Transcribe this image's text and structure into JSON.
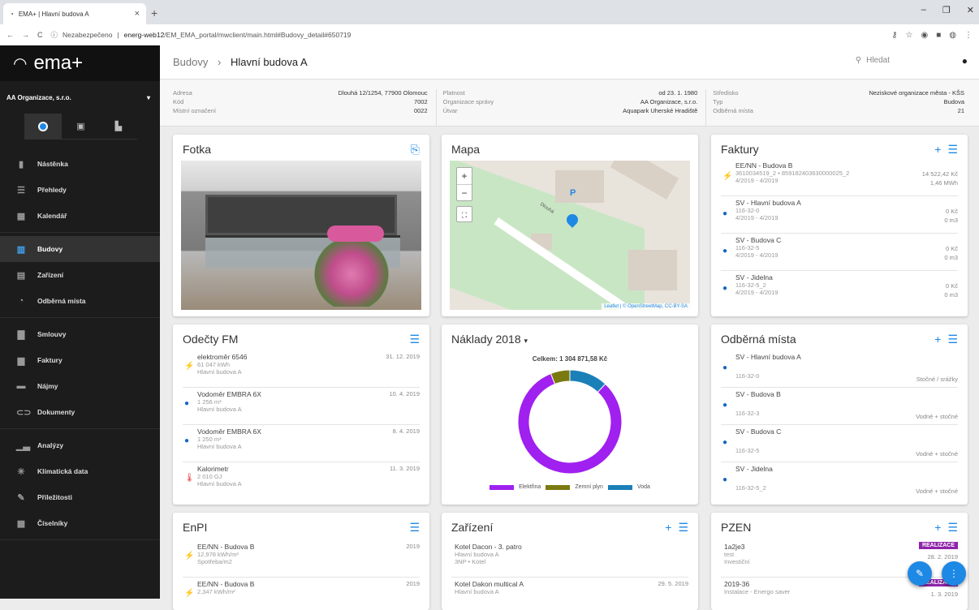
{
  "browser": {
    "tab_title": "EMA+ | Hlavní budova A",
    "security": "Nezabezpečeno",
    "host": "energ-web12",
    "path": "/EM_EMA_portal/mwclient/main.html#Budovy_detail#650719"
  },
  "app": {
    "logo": "ema+",
    "organization": "AA Organizace, s.r.o."
  },
  "nav": [
    {
      "label": "Nástěnka",
      "icon": "dashboard-icon",
      "glyph": "▮"
    },
    {
      "label": "Přehledy",
      "icon": "list-icon",
      "glyph": "☰"
    },
    {
      "label": "Kalendář",
      "icon": "calendar-icon",
      "glyph": "▦"
    },
    {
      "label": "Budovy",
      "icon": "building-icon",
      "glyph": "▥"
    },
    {
      "label": "Zařízení",
      "icon": "device-icon",
      "glyph": "▤"
    },
    {
      "label": "Odběrná místa",
      "icon": "meter-icon",
      "glyph": "◔"
    },
    {
      "label": "Smlouvy",
      "icon": "contract-icon",
      "glyph": "▇"
    },
    {
      "label": "Faktury",
      "icon": "invoice-icon",
      "glyph": "▆"
    },
    {
      "label": "Nájmy",
      "icon": "rent-icon",
      "glyph": "▬"
    },
    {
      "label": "Dokumenty",
      "icon": "document-icon",
      "glyph": "⊂⊃"
    },
    {
      "label": "Analýzy",
      "icon": "analytics-icon",
      "glyph": "▁▃"
    },
    {
      "label": "Klimatická data",
      "icon": "climate-icon",
      "glyph": "✳"
    },
    {
      "label": "Příležitosti",
      "icon": "opportunity-icon",
      "glyph": "✎"
    },
    {
      "label": "Číselníky",
      "icon": "codebook-icon",
      "glyph": "▦"
    }
  ],
  "breadcrumb": {
    "parent": "Budovy",
    "sep": "›",
    "current": "Hlavní budova A"
  },
  "search_label": "Hledat",
  "info": {
    "col1": [
      {
        "k": "Adresa",
        "v": "Dlouhá 12/1254, 77900 Olomouc"
      },
      {
        "k": "Kód",
        "v": "7002"
      },
      {
        "k": "Místní označení",
        "v": "0022"
      }
    ],
    "col2": [
      {
        "k": "Platnost",
        "v": "od 23. 1. 1980"
      },
      {
        "k": "Organizace správy",
        "v": "AA Organizace, s.r.o."
      },
      {
        "k": "Útvar",
        "v": "Aquapark Uherské Hradiště"
      }
    ],
    "col3": [
      {
        "k": "Středisko",
        "v": "Neziskové organizace města - KŠS"
      },
      {
        "k": "Typ",
        "v": "Budova"
      },
      {
        "k": "Odběrná místa",
        "v": "21"
      }
    ]
  },
  "cards": {
    "photo": {
      "title": "Fotka"
    },
    "map": {
      "title": "Mapa",
      "attribution": "Leaflet | © OpenStreetMap, CC-BY-SA",
      "parking": "P",
      "street": "Dlouhá"
    },
    "invoices": {
      "title": "Faktury",
      "items": [
        {
          "name": "EE/NN - Budova B",
          "ids": "3610034519_2 • 859182403630000025_2",
          "period": "4/2019 - 4/2019",
          "amount": "14 522,42 Kč",
          "qty": "1,46 MWh",
          "type": "bolt"
        },
        {
          "name": "SV - Hlavní budova A",
          "ids": "116-32-0",
          "period": "4/2019 - 4/2019",
          "amount": "0 Kč",
          "qty": "0 m3",
          "type": "drop"
        },
        {
          "name": "SV - Budova C",
          "ids": "116-32-5",
          "period": "4/2019 - 4/2019",
          "amount": "0 Kč",
          "qty": "0 m3",
          "type": "drop"
        },
        {
          "name": "SV - Jidelna",
          "ids": "116-32-5_2",
          "period": "4/2019 - 4/2019",
          "amount": "0 Kč",
          "qty": "0 m3",
          "type": "drop"
        }
      ]
    },
    "readings": {
      "title": "Odečty FM",
      "items": [
        {
          "name": "elektroměr 6546",
          "value": "61 047 kWh",
          "place": "Hlavní budova A",
          "date": "31. 12. 2019",
          "type": "bolt"
        },
        {
          "name": "Vodoměr EMBRA 6X",
          "value": "1 256 m³",
          "place": "Hlavní budova A",
          "date": "10. 4. 2019",
          "type": "drop"
        },
        {
          "name": "Vodoměr EMBRA 6X",
          "value": "1 250 m³",
          "place": "Hlavní budova A",
          "date": "8. 4. 2019",
          "type": "drop"
        },
        {
          "name": "Kalorimetr",
          "value": "2 010 GJ",
          "place": "Hlavní budova A",
          "date": "11. 3. 2019",
          "type": "therm"
        }
      ]
    },
    "costs": {
      "title": "Náklady 2018",
      "total": "Celkem: 1 304 871,58 Kč"
    },
    "points": {
      "title": "Odběrná místa",
      "items": [
        {
          "name": "SV - Hlavní budova A",
          "code": "116-32-0",
          "kind": "Stočné / srážky"
        },
        {
          "name": "SV - Budova B",
          "code": "116-32-3",
          "kind": "Vodné + stočné"
        },
        {
          "name": "SV - Budova C",
          "code": "116-32-5",
          "kind": "Vodné + stočné"
        },
        {
          "name": "SV - Jidelna",
          "code": "116-32-5_2",
          "kind": "Vodné + stočné"
        }
      ]
    },
    "enpi": {
      "title": "EnPI",
      "items": [
        {
          "name": "EE/NN - Budova B",
          "value": "12,978 kWh/m²",
          "label": "Spotřeba/m2",
          "year": "2019"
        },
        {
          "name": "EE/NN - Budova B",
          "value": "2,347 kWh/m²",
          "label": "",
          "year": "2019"
        }
      ]
    },
    "devices": {
      "title": "Zařízení",
      "items": [
        {
          "name": "Kotel Dacon - 3. patro",
          "place": "Hlavní budova A",
          "meta": "3NP • Kotel",
          "date": ""
        },
        {
          "name": "Kotel Dakon multical A",
          "place": "Hlavní budova A",
          "meta": "",
          "date": "29. 5. 2019"
        }
      ]
    },
    "pzen": {
      "title": "PZEN",
      "items": [
        {
          "name": "1a2je3",
          "sub": "test",
          "sub2": "Investiční",
          "badge": "REALIZACE",
          "date": "28. 2. 2019"
        },
        {
          "name": "2019-36",
          "sub": "Instalace - Energo saver",
          "sub2": "",
          "badge": "REALIZACE",
          "date": "1. 3. 2019"
        }
      ]
    }
  },
  "chart_data": {
    "type": "pie",
    "title": "Celkem: 1 304 871,58 Kč",
    "categories": [
      "Elektřina",
      "Zemní plyn",
      "Voda"
    ],
    "values": [
      82,
      6,
      12
    ],
    "colors": [
      "#a020f0",
      "#7a7a10",
      "#1b7fb8"
    ],
    "donut": true,
    "legend": "bottom"
  }
}
